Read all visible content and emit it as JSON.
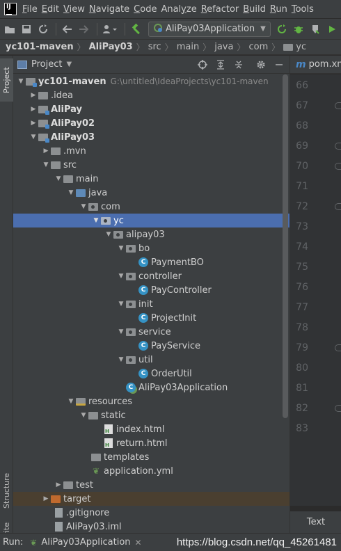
{
  "menu": [
    "File",
    "Edit",
    "View",
    "Navigate",
    "Code",
    "Analyze",
    "Refactor",
    "Build",
    "Run",
    "Tools"
  ],
  "menu_mnemonic_index": [
    0,
    0,
    0,
    0,
    0,
    4,
    0,
    0,
    0,
    0
  ],
  "toolbar": {
    "run_config": "AliPay03Application"
  },
  "breadcrumb": [
    "yc101-maven",
    "AliPay03",
    "src",
    "main",
    "java",
    "com",
    "yc"
  ],
  "left_strip": {
    "project": "Project",
    "structure": "Structure",
    "favorites": "Favorites"
  },
  "panel": {
    "title": "Project"
  },
  "tree": [
    {
      "label": "yc101-maven",
      "path": "G:\\untitled\\IdeaProjects\\yc101-maven",
      "bold": true
    },
    {
      "label": ".idea"
    },
    {
      "label": "AliPay",
      "bold": true
    },
    {
      "label": "AliPay02",
      "bold": true
    },
    {
      "label": "AliPay03",
      "bold": true
    },
    {
      "label": ".mvn"
    },
    {
      "label": "src"
    },
    {
      "label": "main"
    },
    {
      "label": "java"
    },
    {
      "label": "com"
    },
    {
      "label": "yc"
    },
    {
      "label": "alipay03"
    },
    {
      "label": "bo"
    },
    {
      "label": "PaymentBO"
    },
    {
      "label": "controller"
    },
    {
      "label": "PayController"
    },
    {
      "label": "init"
    },
    {
      "label": "ProjectInit"
    },
    {
      "label": "service"
    },
    {
      "label": "PayService"
    },
    {
      "label": "util"
    },
    {
      "label": "OrderUtil"
    },
    {
      "label": "AliPay03Application"
    },
    {
      "label": "resources"
    },
    {
      "label": "static"
    },
    {
      "label": "index.html"
    },
    {
      "label": "return.html"
    },
    {
      "label": "templates"
    },
    {
      "label": "application.yml"
    },
    {
      "label": "test"
    },
    {
      "label": "target"
    },
    {
      "label": ".gitignore"
    },
    {
      "label": "AliPay03.iml"
    }
  ],
  "editor": {
    "tab": "pom.xml",
    "line_numbers": [
      "66",
      "67",
      "68",
      "69",
      "70",
      "71",
      "72",
      "73",
      "74",
      "75",
      "76",
      "77",
      "78",
      "79",
      "80",
      "81",
      "82",
      "83"
    ],
    "bottom_tab": "Text"
  },
  "runbar": {
    "label": "Run:",
    "tab": "AliPay03Application"
  },
  "watermark": "https://blog.csdn.net/qq_45261481",
  "colors": {
    "selection": "#4b6eaf",
    "excluded_row": "#4a3f30",
    "class_icon": "#3592c4",
    "spring_icon": "#6a9955",
    "target_folder": "#c06a2e"
  }
}
